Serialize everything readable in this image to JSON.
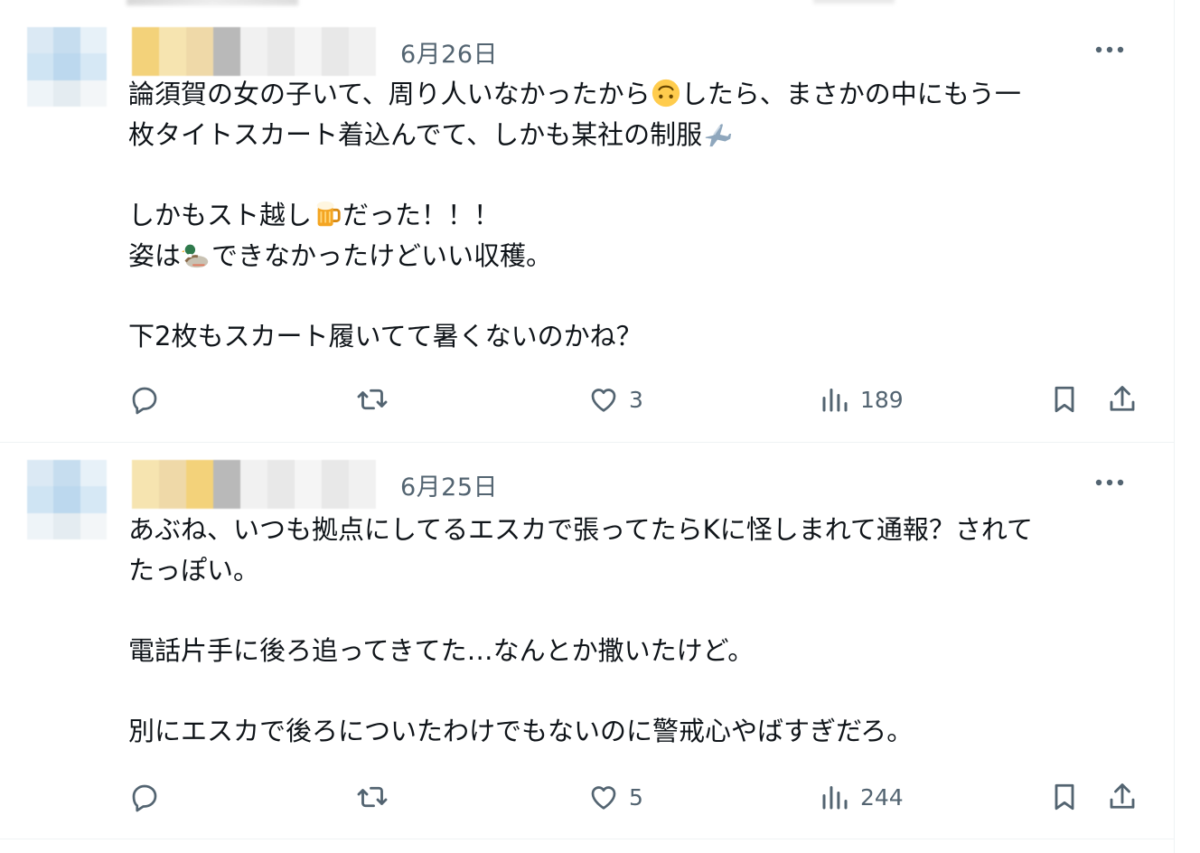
{
  "tweets": [
    {
      "date": "6月26日",
      "paragraphs": [
        {
          "lines": [
            [
              {
                "t": "論須賀の女の子いて、周り人いなかったから"
              },
              {
                "emoji": "upside-down-face-emoji"
              },
              {
                "t": "したら、まさかの中にもう一"
              }
            ],
            [
              {
                "t": "枚タイトスカート着込んでて、しかも某社の制服"
              },
              {
                "emoji": "airplane-emoji"
              }
            ]
          ]
        },
        {
          "lines": [
            [
              {
                "t": "しかもスト越し"
              },
              {
                "emoji": "beer-mug-emoji"
              },
              {
                "t": "だった！！！"
              }
            ],
            [
              {
                "t": "姿は"
              },
              {
                "emoji": "duck-emoji"
              },
              {
                "t": "できなかったけどいい収穫。"
              }
            ]
          ]
        },
        {
          "lines": [
            [
              {
                "t": "下2枚もスカート履いてて暑くないのかね？"
              }
            ]
          ]
        }
      ],
      "stats": {
        "replies": "",
        "reposts": "",
        "likes": "3",
        "views": "189"
      }
    },
    {
      "date": "6月25日",
      "paragraphs": [
        {
          "lines": [
            [
              {
                "t": "あぶね、いつも拠点にしてるエスカで張ってたらKに怪しまれて通報？されて"
              }
            ],
            [
              {
                "t": "たっぽい。"
              }
            ]
          ]
        },
        {
          "lines": [
            [
              {
                "t": "電話片手に後ろ追ってきてた…なんとか撒いたけど。"
              }
            ]
          ]
        },
        {
          "lines": [
            [
              {
                "t": "別にエスカで後ろについたわけでもないのに警戒心やばすぎだろ。"
              }
            ]
          ]
        }
      ],
      "stats": {
        "replies": "",
        "reposts": "",
        "likes": "5",
        "views": "244"
      }
    }
  ],
  "icons": {
    "reply": "reply-icon",
    "repost": "repost-icon",
    "like": "heart-icon",
    "views": "views-chart-icon",
    "bookmark": "bookmark-icon",
    "share": "share-icon",
    "more": "more-dots-icon"
  },
  "colors": {
    "secondary_text": "#536471",
    "primary_text": "#0f1419",
    "divider": "#eff3f4"
  }
}
